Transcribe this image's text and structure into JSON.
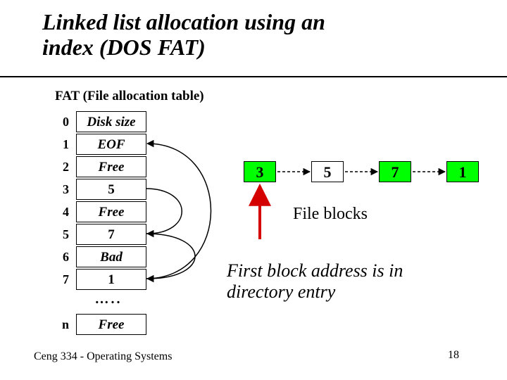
{
  "slide": {
    "title_line1": "Linked list allocation using an",
    "title_line2": "index (DOS FAT)",
    "fat_caption": "FAT (File allocation table)",
    "footer": "Ceng 334 - Operating Systems",
    "page_number": "18"
  },
  "fat": {
    "rows": [
      {
        "index": "0",
        "value": "Disk size",
        "italic": true
      },
      {
        "index": "1",
        "value": "EOF",
        "italic": true
      },
      {
        "index": "2",
        "value": "Free",
        "italic": true
      },
      {
        "index": "3",
        "value": "5",
        "italic": false
      },
      {
        "index": "4",
        "value": "Free",
        "italic": true
      },
      {
        "index": "5",
        "value": "7",
        "italic": false
      },
      {
        "index": "6",
        "value": "Bad",
        "italic": true
      },
      {
        "index": "7",
        "value": "1",
        "italic": false
      }
    ],
    "ellipsis": "…..",
    "last": {
      "index": "n",
      "value": "Free",
      "italic": true
    }
  },
  "blocks": {
    "sequence": [
      "3",
      "5",
      "7",
      "1"
    ],
    "label": "File blocks"
  },
  "caption": {
    "line1": "First block address is in",
    "line2": "directory entry"
  },
  "colors": {
    "block_highlight": "#00ff00",
    "arrow_red": "#d40000"
  }
}
